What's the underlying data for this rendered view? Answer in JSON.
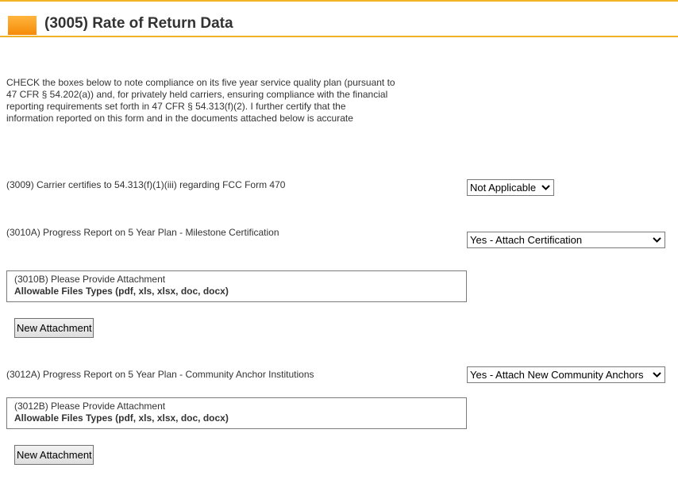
{
  "header": {
    "title": "(3005) Rate of Return Data"
  },
  "intro": {
    "text": "CHECK the boxes below to note compliance on its five year service quality plan (pursuant to 47 CFR § 54.202(a)) and, for privately held carriers, ensuring compliance with the financial reporting requirements set forth in 47 CFR § 54.313(f)(2). I further certify that the information reported on this form and in the documents attached below is accurate"
  },
  "q3009": {
    "label": "(3009) Carrier certifies to 54.313(f)(1)(iii) regarding FCC Form 470",
    "selected": "Not Applicable"
  },
  "q3010a": {
    "label": "(3010A) Progress Report on 5 Year Plan - Milestone Certification",
    "selected": "Yes - Attach Certification"
  },
  "q3010b": {
    "title": "(3010B) Please Provide Attachment",
    "types": "Allowable Files Types (pdf, xls, xlsx, doc, docx)",
    "button": "New Attachment"
  },
  "q3012a": {
    "label": "(3012A) Progress Report on 5 Year Plan - Community Anchor Institutions",
    "selected": "Yes - Attach New Community Anchors"
  },
  "q3012b": {
    "title": "(3012B) Please Provide Attachment",
    "types": "Allowable Files Types (pdf, xls, xlsx, doc, docx)",
    "button": "New Attachment"
  },
  "icons": {
    "header": "section-marker-icon",
    "dropdown": "chevron-down-icon"
  },
  "colors": {
    "accent_line": "#f0b323",
    "header_icon": "#f58a07"
  }
}
